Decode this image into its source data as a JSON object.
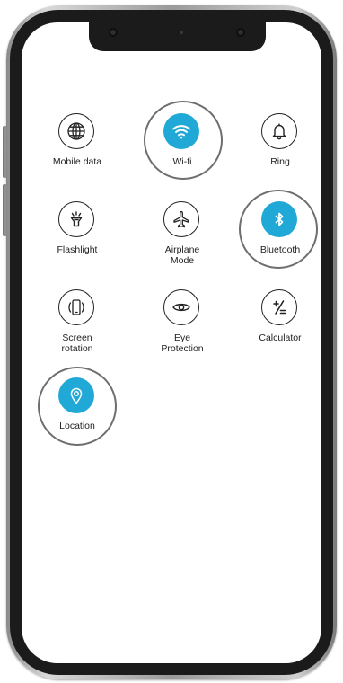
{
  "colors": {
    "active": "#20a9d6",
    "icon_stroke": "#222222",
    "highlight_ring": "#6e6e6e"
  },
  "tiles": [
    {
      "label": "Mobile data",
      "icon": "globe-icon",
      "active": false
    },
    {
      "label": "Wi-fi",
      "icon": "wifi-icon",
      "active": true
    },
    {
      "label": "Ring",
      "icon": "bell-icon",
      "active": false
    },
    {
      "label": "Flashlight",
      "icon": "flashlight-icon",
      "active": false
    },
    {
      "label": "Airplane\nMode",
      "icon": "airplane-icon",
      "active": false
    },
    {
      "label": "Bluetooth",
      "icon": "bluetooth-icon",
      "active": true
    },
    {
      "label": "Screen\nrotation",
      "icon": "screen-rotation-icon",
      "active": false
    },
    {
      "label": "Eye\nProtection",
      "icon": "eye-icon",
      "active": false
    },
    {
      "label": "Calculator",
      "icon": "calculator-icon",
      "active": false
    },
    {
      "label": "Location",
      "icon": "location-pin-icon",
      "active": true
    }
  ]
}
